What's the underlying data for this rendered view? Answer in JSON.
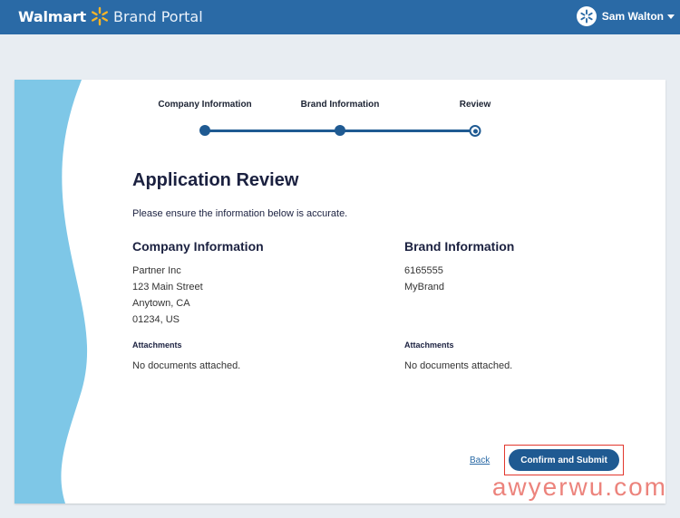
{
  "header": {
    "brand_name": "Walmart",
    "product_name": "Brand Portal",
    "user_name": "Sam Walton",
    "icons": [
      "walmart-spark-icon",
      "avatar-spark-icon",
      "chevron-down-icon"
    ],
    "colors": {
      "bar": "#2a6aa6",
      "spark": "#f7b528"
    }
  },
  "stepper": {
    "steps": [
      {
        "label": "Company Information",
        "state": "complete"
      },
      {
        "label": "Brand Information",
        "state": "complete"
      },
      {
        "label": "Review",
        "state": "current"
      }
    ],
    "color": "#1f5a92"
  },
  "review": {
    "title": "Application Review",
    "subtitle": "Please ensure the information below is accurate.",
    "company": {
      "heading": "Company Information",
      "lines": [
        "Partner Inc",
        "123 Main Street",
        "Anytown, CA",
        "01234, US"
      ],
      "attachments_heading": "Attachments",
      "attachments_value": "No documents attached."
    },
    "brand": {
      "heading": "Brand Information",
      "lines": [
        "6165555",
        "MyBrand"
      ],
      "attachments_heading": "Attachments",
      "attachments_value": "No documents attached."
    }
  },
  "actions": {
    "back_label": "Back",
    "submit_label": "Confirm and Submit",
    "highlight_color": "#e2372d"
  },
  "watermark": "awyerwu.com"
}
